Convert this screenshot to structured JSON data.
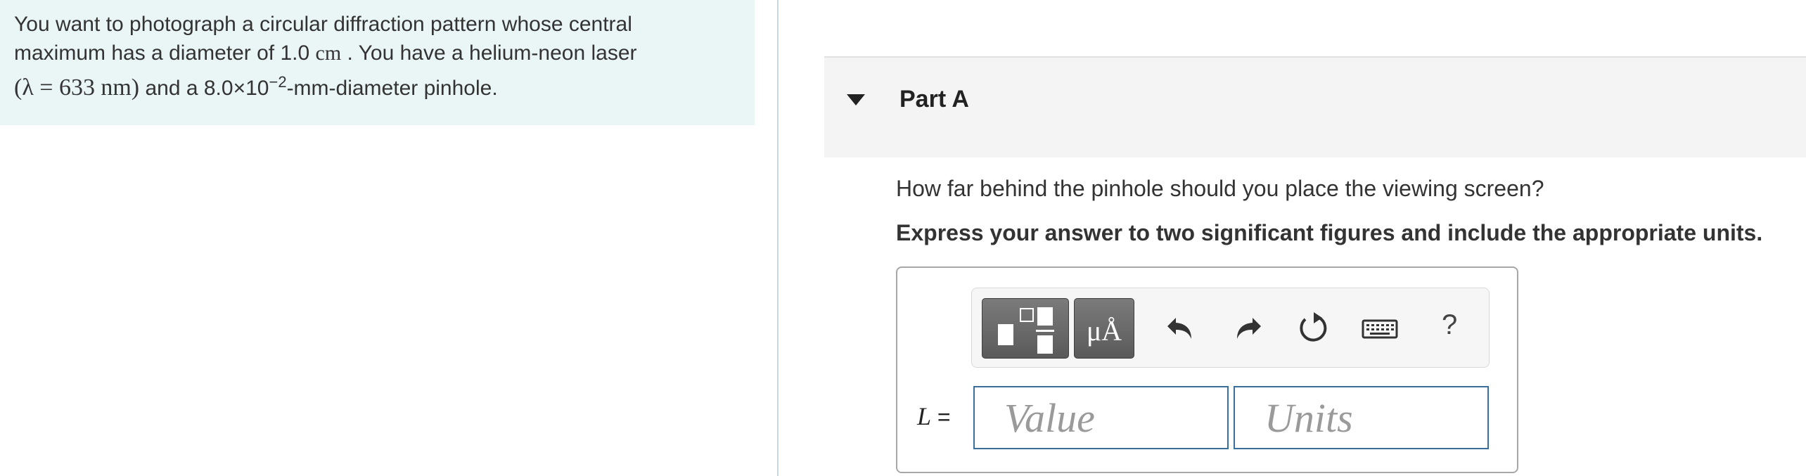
{
  "problem": {
    "text_1": "You want to photograph a circular diffraction pattern whose central",
    "text_2a": "maximum has a diameter of 1.0",
    "unit_cm": "cm",
    "text_2b": ". You have a helium-neon laser",
    "lambda_expr": "(λ = 633",
    "unit_nm": "nm)",
    "text_3a": "and a 8.0×10",
    "exponent": "−2",
    "text_3b": "-mm-diameter pinhole."
  },
  "part": {
    "title": "Part A",
    "question": "How far behind the pinhole should you place the viewing screen?",
    "instruction": "Express your answer to two significant figures and include the appropriate units."
  },
  "toolbar": {
    "units_label": "μÅ",
    "help_label": "?"
  },
  "answer": {
    "variable": "L",
    "equals": "=",
    "value_placeholder": "Value",
    "units_placeholder": "Units"
  },
  "colors": {
    "problem_bg": "#eaf6f6",
    "header_bg": "#f4f4f4",
    "field_border": "#3a6e9c",
    "toolbar_dark": "#6a6a6a"
  }
}
